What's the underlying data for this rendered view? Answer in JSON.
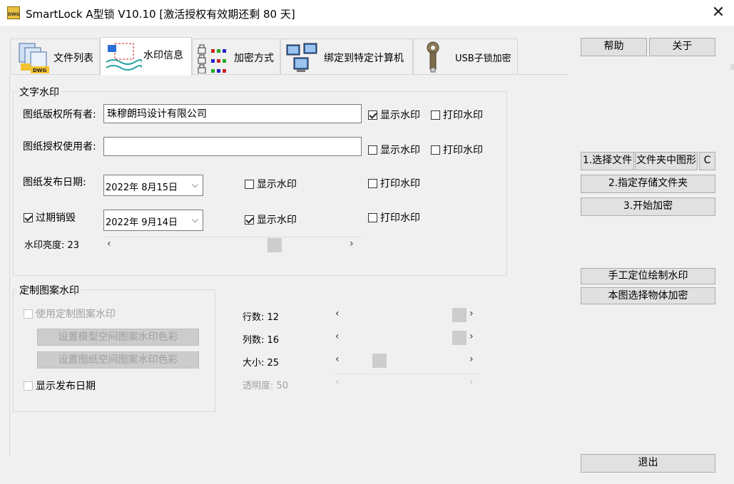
{
  "window": {
    "title": "SmartLock A型锁  V10.10 [激活授权有效期还剩 80 天]",
    "app_icon_text": "DWG",
    "close_glyph": "✕"
  },
  "tabs": [
    {
      "label": "文件列表",
      "icon": "dwg-files-icon",
      "active": false
    },
    {
      "label": "水印信息",
      "icon": "watermark-icon",
      "active": true
    },
    {
      "label": "加密方式",
      "icon": "lock-grid-icon",
      "active": false
    },
    {
      "label": "绑定到特定计算机",
      "icon": "computers-icon",
      "active": false
    },
    {
      "label": "USB子锁加密",
      "icon": "usb-key-icon",
      "active": false
    }
  ],
  "text_watermark": {
    "group_title": "文字水印",
    "owner_label": "图纸版权所有者:",
    "owner_value": "珠穆朗玛设计有限公司",
    "user_label": "图纸授权使用者:",
    "user_value": "",
    "release_label": "图纸发布日期:",
    "release_date": "2022年  8月15日",
    "expire_label": "过期销毁",
    "expire_checked": true,
    "expire_date": "2022年  9月14日",
    "show_wm": "显示水印",
    "print_wm": "打印水印",
    "checks": {
      "owner_show": true,
      "owner_print": false,
      "user_show": false,
      "user_print": false,
      "release_show": false,
      "release_print": false,
      "expire_show": true,
      "expire_print": false
    },
    "brightness_label": "水印亮度: 23",
    "brightness_value": 23
  },
  "pattern_watermark": {
    "group_title": "定制图案水印",
    "use_pattern_label": "使用定制图案水印",
    "model_color_btn": "设置模型空间图案水印色彩",
    "paper_color_btn": "设置图纸空间图案水印色彩",
    "show_date_label": "显示发布日期",
    "rows_label": "行数: 12",
    "rows_value": 12,
    "cols_label": "列数: 16",
    "cols_value": 16,
    "size_label": "大小: 25",
    "size_value": 25,
    "opacity_label": "透明度: 50",
    "opacity_value": 50
  },
  "right_panel": {
    "help": "帮助",
    "about": "关于",
    "select_files": "1.选择文件",
    "folder_drawings": "文件夹中图形",
    "c_btn": "C",
    "set_folder": "2.指定存储文件夹",
    "start_encrypt": "3.开始加密",
    "manual_wm": "手工定位绘制水印",
    "select_objects": "本图选择物体加密",
    "exit": "退出"
  },
  "glyphs": {
    "left": "‹",
    "right": "›",
    "chev": "⌵"
  }
}
